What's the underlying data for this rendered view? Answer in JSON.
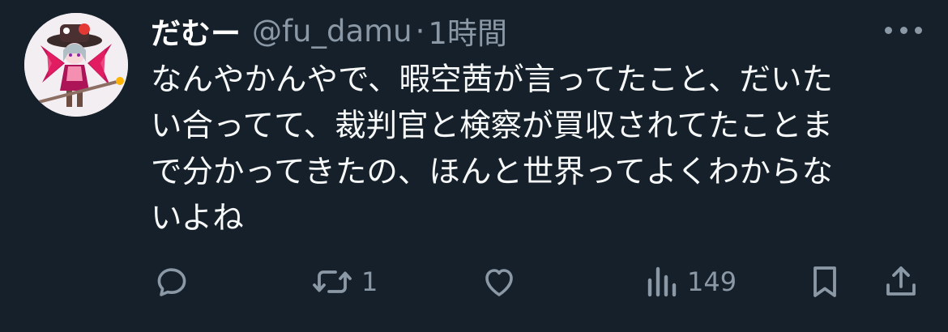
{
  "tweet": {
    "display_name": "だむー",
    "handle": "@fu_damu",
    "separator": "·",
    "time": "1時間",
    "lines": [
      "なんやかんやで、暇空茜が言ってたこと、だいた",
      "い合ってて、裁判官と検察が買収されてたことま",
      "で分かってきたの、ほんと世界ってよくわからな",
      "いよね"
    ]
  },
  "actions": {
    "reply": {
      "icon": "reply-icon",
      "count": ""
    },
    "repost": {
      "icon": "repost-icon",
      "count": "1"
    },
    "like": {
      "icon": "heart-icon",
      "count": ""
    },
    "views": {
      "icon": "views-icon",
      "count": "149"
    },
    "bookmark": {
      "icon": "bookmark-icon"
    },
    "share": {
      "icon": "share-icon"
    }
  },
  "colors": {
    "background": "#15202b",
    "primary_text": "#f7f9f9",
    "secondary_text": "#8b98a5"
  }
}
